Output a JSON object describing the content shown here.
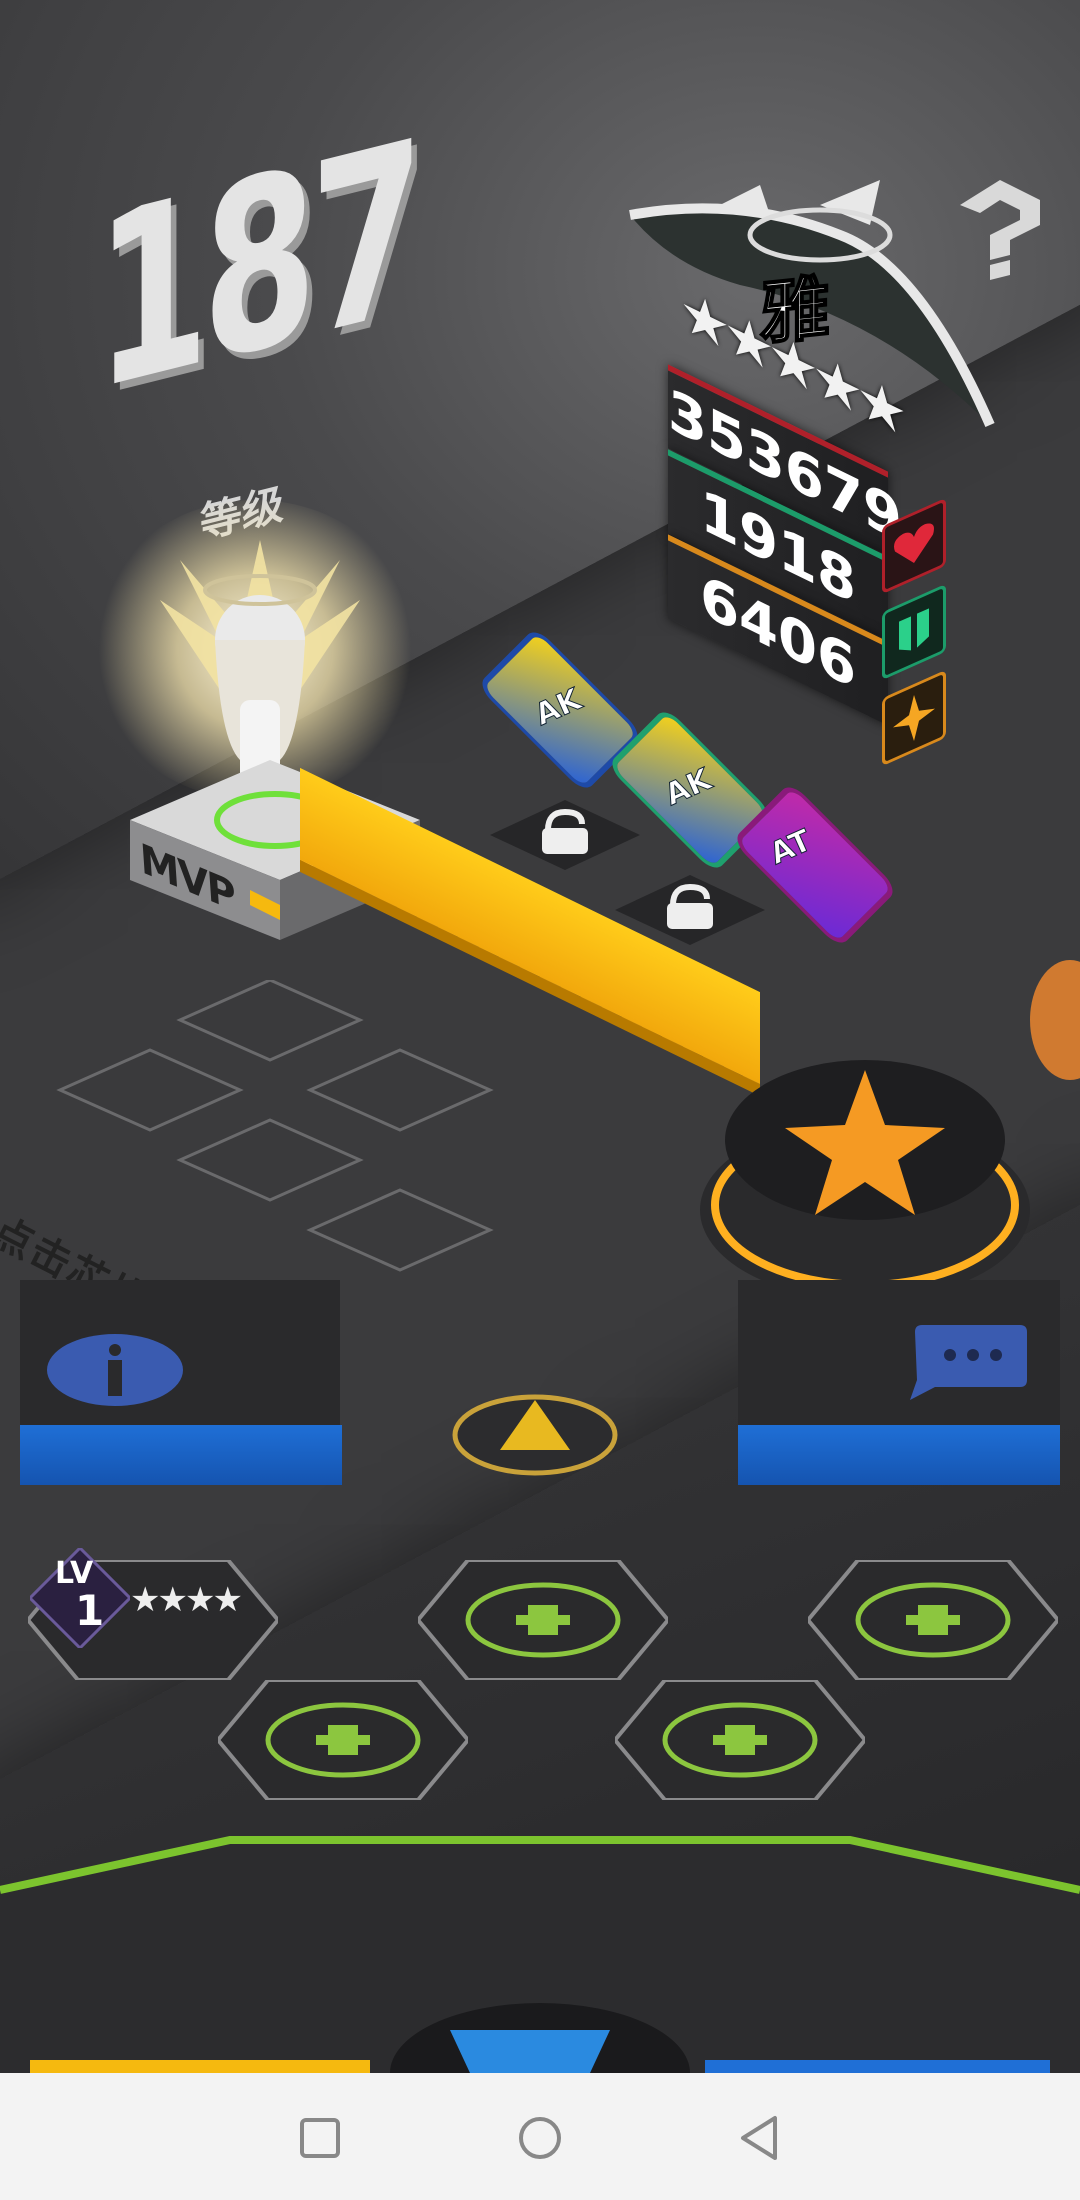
{
  "level": {
    "number": "187",
    "label": "等级"
  },
  "character": {
    "name": "雅",
    "stars": 5
  },
  "stats": {
    "hp": "353679",
    "defense": "1918",
    "attack": "6406"
  },
  "pedestal_label": "MVP",
  "chips": [
    {
      "label": "AK",
      "color": "#2a62d6"
    },
    {
      "label": "AK",
      "color": "#1fa06e"
    },
    {
      "label": "AT",
      "color": "#c22aa8"
    }
  ],
  "hint": "点击芯片可查看详情",
  "team_slot": {
    "lv_label": "LV",
    "lv_value": "1",
    "stars": "★★★★"
  },
  "icons": [
    "help-icon",
    "heart-icon",
    "shield-icon",
    "star-icon",
    "lock-icon",
    "info-icon",
    "chat-icon",
    "triangle-up-icon",
    "plus-icon",
    "square-nav-icon",
    "circle-nav-icon",
    "back-nav-icon"
  ],
  "colors": {
    "accent_yellow": "#f5b90f",
    "blue": "#1f6fd6",
    "hp": "#b0202a",
    "def": "#1c9c6a",
    "atk": "#d8891c"
  }
}
